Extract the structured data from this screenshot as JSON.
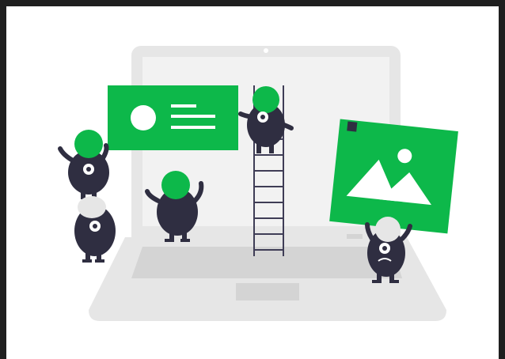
{
  "illustration": {
    "subject": "laptop-with-monster-characters",
    "colors": {
      "frame_background": "#1f1f1f",
      "canvas": "#ffffff",
      "laptop_body": "#e6e6e6",
      "laptop_screen": "#f2f2f2",
      "keyboard_area": "#d4d4d4",
      "accent_green": "#0db84a",
      "monster": "#2f2e41",
      "monster_helmet_alt": "#e6e6e6",
      "card_detail": "#ffffff"
    },
    "icons": [
      "profile-card-icon",
      "image-placeholder-icon",
      "ladder",
      "laptop"
    ]
  }
}
